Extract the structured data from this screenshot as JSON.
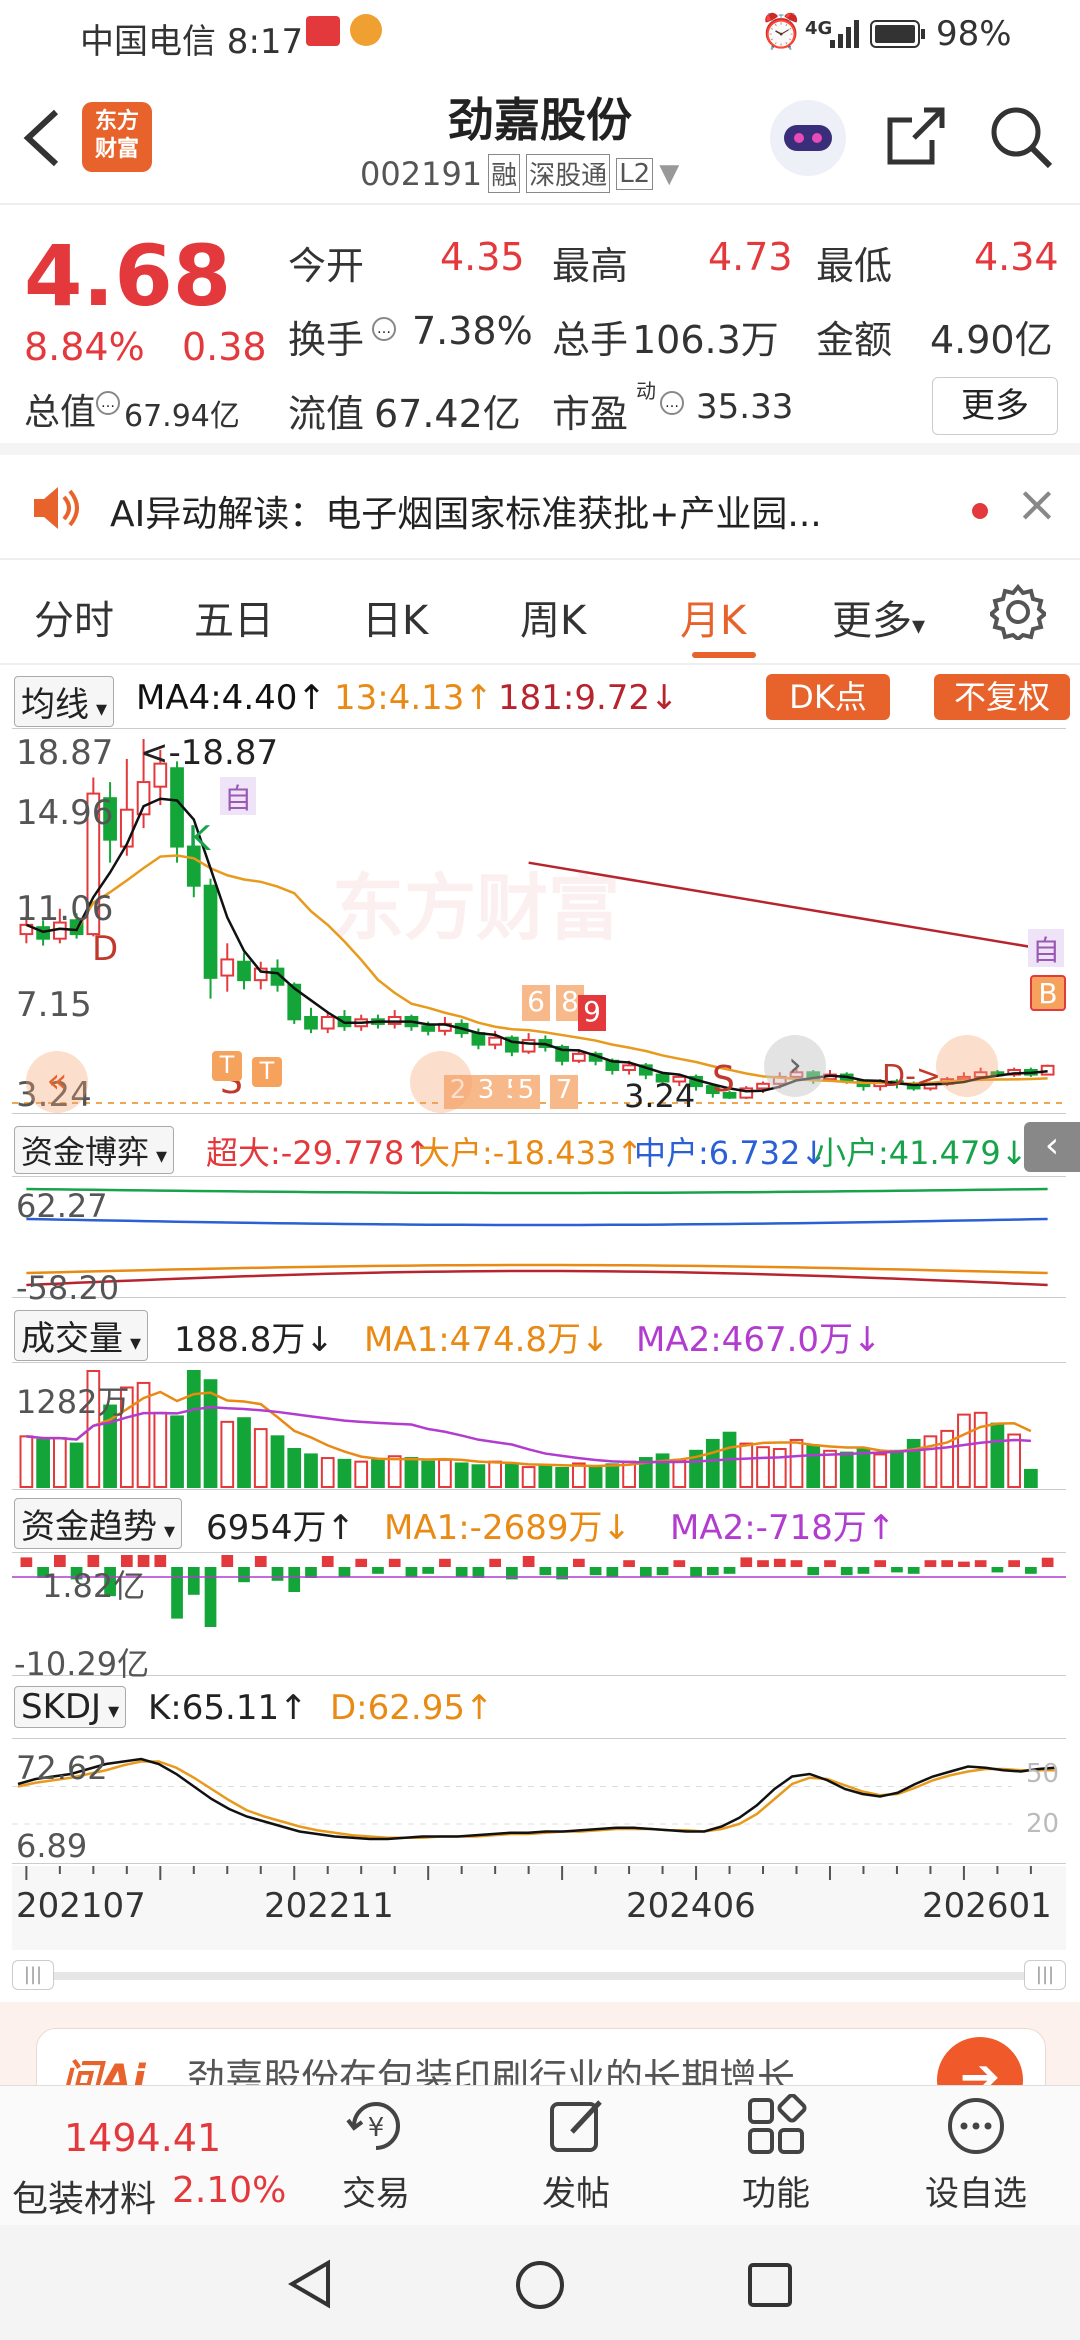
{
  "status_bar": {
    "time_carrier": "中国电信 8:17",
    "signal": "4G",
    "battery": "98%"
  },
  "header": {
    "title": "劲嘉股份",
    "code": "002191",
    "badges": [
      "融",
      "深股通",
      "L2"
    ],
    "brand": "东方\n财富"
  },
  "quote": {
    "price": "4.68",
    "change_pct": "8.84%",
    "change": "0.38",
    "open_label": "今开",
    "open": "4.35",
    "high_label": "最高",
    "high": "4.73",
    "low_label": "最低",
    "low": "4.34",
    "turnover_label": "换手",
    "turnover": "7.38%",
    "volume_label": "总手",
    "volume": "106.3万",
    "amount_label": "金额",
    "amount": "4.90亿",
    "mktcap_label": "总值",
    "mktcap": "67.94亿",
    "float_label": "流值",
    "float_cap": "67.42亿",
    "pe_label": "市盈",
    "pe_sup": "动",
    "pe": "35.33",
    "more_button": "更多"
  },
  "ai_banner": {
    "text": "AI异动解读：电子烟国家标准获批+产业园...",
    "close": "×"
  },
  "tabs": {
    "items": [
      "分时",
      "五日",
      "日K",
      "周K",
      "月K",
      "更多"
    ],
    "active": 4,
    "more_caret": "▾"
  },
  "kline": {
    "indicator_label": "均线",
    "ma4": "MA4:4.40↑",
    "ma13": "13:4.13↑",
    "ma181": "181:9.72↓",
    "dk_button": "DK点",
    "adjust_button": "不复权",
    "y_labels": [
      "18.87",
      "14.96",
      "11.06",
      "7.15",
      "3.24"
    ],
    "max_annotation": "<-18.87",
    "min_annotation": "3.24",
    "watermark": "东方财富",
    "markers": {
      "zi": "自",
      "k": "K",
      "d": "D",
      "s": "S",
      "t": "T",
      "b": "B"
    },
    "number_tags": [
      "2",
      "3",
      "5",
      "5",
      "7",
      "6",
      "8",
      "9"
    ],
    "ddash": "D->",
    "colors": {
      "up": "#e4393c",
      "down": "#13a538",
      "ma4": "#111111",
      "ma13": "#e89a1c",
      "ma181": "#b8242e"
    }
  },
  "capital_game": {
    "label": "资金博弈",
    "super": "超大:-29.778↑",
    "large": "大户:-18.433↑",
    "mid": "中户:6.732↓",
    "small": "小户:41.479↓",
    "y_labels": [
      "62.27",
      "-58.20"
    ]
  },
  "volume": {
    "label": "成交量",
    "value": "188.8万↓",
    "ma1": "MA1:474.8万↓",
    "ma2": "MA2:467.0万↓",
    "y_labels": [
      "1282万"
    ]
  },
  "fund_trend": {
    "label": "资金趋势",
    "value": "6954万↑",
    "ma1": "MA1:-2689万↓",
    "ma2": "MA2:-718万↑",
    "y_labels": [
      "1.82亿",
      "-10.29亿"
    ]
  },
  "skdj": {
    "label": "SKDJ",
    "k": "K:65.11↑",
    "d": "D:62.95↑",
    "y_labels": [
      "72.62",
      "6.89"
    ],
    "right_labels": [
      "50",
      "20"
    ]
  },
  "x_axis": [
    "202107",
    "202211",
    "202406",
    "202601"
  ],
  "promo": {
    "text": "劲嘉股份在包装印刷行业的长期增长"
  },
  "bottom_bar": {
    "index_value": "1494.41",
    "index_name": "包装材料",
    "index_pct": "2.10%",
    "items": [
      {
        "label": "交易",
        "icon": "trade-icon"
      },
      {
        "label": "发帖",
        "icon": "post-icon"
      },
      {
        "label": "功能",
        "icon": "function-icon"
      },
      {
        "label": "设自选",
        "icon": "watchlist-icon"
      }
    ]
  },
  "chart_data": {
    "type": "candlestick",
    "title": "劲嘉股份 月K",
    "x_ticks": [
      "202107",
      "202211",
      "202406",
      "202601"
    ],
    "ylim": [
      3.24,
      18.87
    ],
    "y_ticks": [
      18.87,
      14.96,
      11.06,
      7.15,
      3.24
    ],
    "candles": [
      {
        "o": 10.4,
        "c": 10.8,
        "h": 11.2,
        "l": 10.0
      },
      {
        "o": 10.7,
        "c": 10.2,
        "h": 11.0,
        "l": 9.9
      },
      {
        "o": 10.2,
        "c": 10.9,
        "h": 11.5,
        "l": 10.0
      },
      {
        "o": 11.0,
        "c": 10.4,
        "h": 11.3,
        "l": 10.2
      },
      {
        "o": 10.4,
        "c": 16.5,
        "h": 17.2,
        "l": 10.3
      },
      {
        "o": 16.3,
        "c": 14.5,
        "h": 17.0,
        "l": 13.5
      },
      {
        "o": 14.2,
        "c": 15.8,
        "h": 18.0,
        "l": 13.8
      },
      {
        "o": 15.6,
        "c": 17.0,
        "h": 18.87,
        "l": 15.0
      },
      {
        "o": 16.8,
        "c": 17.8,
        "h": 18.4,
        "l": 16.0
      },
      {
        "o": 17.6,
        "c": 14.2,
        "h": 17.9,
        "l": 13.5
      },
      {
        "o": 14.2,
        "c": 12.5,
        "h": 14.5,
        "l": 12.0
      },
      {
        "o": 12.5,
        "c": 8.5,
        "h": 12.8,
        "l": 7.6
      },
      {
        "o": 8.6,
        "c": 9.3,
        "h": 10.0,
        "l": 7.9
      },
      {
        "o": 9.2,
        "c": 8.4,
        "h": 9.6,
        "l": 8.0
      },
      {
        "o": 8.4,
        "c": 8.9,
        "h": 9.2,
        "l": 8.0
      },
      {
        "o": 8.9,
        "c": 8.2,
        "h": 9.3,
        "l": 7.9
      },
      {
        "o": 8.2,
        "c": 6.7,
        "h": 8.3,
        "l": 6.5
      },
      {
        "o": 6.8,
        "c": 6.3,
        "h": 7.2,
        "l": 6.1
      },
      {
        "o": 6.3,
        "c": 6.8,
        "h": 7.0,
        "l": 6.1
      },
      {
        "o": 6.8,
        "c": 6.4,
        "h": 7.1,
        "l": 6.2
      },
      {
        "o": 6.4,
        "c": 6.7,
        "h": 6.9,
        "l": 6.2
      },
      {
        "o": 6.7,
        "c": 6.5,
        "h": 6.9,
        "l": 6.3
      },
      {
        "o": 6.5,
        "c": 6.8,
        "h": 7.1,
        "l": 6.3
      },
      {
        "o": 6.8,
        "c": 6.4,
        "h": 6.9,
        "l": 6.2
      },
      {
        "o": 6.4,
        "c": 6.2,
        "h": 6.6,
        "l": 6.0
      },
      {
        "o": 6.2,
        "c": 6.5,
        "h": 6.8,
        "l": 6.0
      },
      {
        "o": 6.5,
        "c": 6.1,
        "h": 6.7,
        "l": 5.9
      },
      {
        "o": 6.1,
        "c": 5.6,
        "h": 6.3,
        "l": 5.4
      },
      {
        "o": 5.6,
        "c": 5.9,
        "h": 6.2,
        "l": 5.4
      },
      {
        "o": 5.9,
        "c": 5.3,
        "h": 6.0,
        "l": 5.1
      },
      {
        "o": 5.3,
        "c": 5.8,
        "h": 6.1,
        "l": 5.2
      },
      {
        "o": 5.8,
        "c": 5.5,
        "h": 6.0,
        "l": 5.3
      },
      {
        "o": 5.5,
        "c": 4.9,
        "h": 5.6,
        "l": 4.7
      },
      {
        "o": 4.9,
        "c": 5.2,
        "h": 5.4,
        "l": 4.8
      },
      {
        "o": 5.2,
        "c": 4.9,
        "h": 5.3,
        "l": 4.7
      },
      {
        "o": 4.9,
        "c": 4.5,
        "h": 5.0,
        "l": 4.3
      },
      {
        "o": 4.5,
        "c": 4.7,
        "h": 4.9,
        "l": 4.3
      },
      {
        "o": 4.7,
        "c": 4.3,
        "h": 4.8,
        "l": 4.1
      },
      {
        "o": 4.3,
        "c": 4.0,
        "h": 4.4,
        "l": 3.8
      },
      {
        "o": 4.0,
        "c": 4.2,
        "h": 4.3,
        "l": 3.8
      },
      {
        "o": 4.2,
        "c": 3.8,
        "h": 4.3,
        "l": 3.6
      },
      {
        "o": 3.8,
        "c": 3.5,
        "h": 3.9,
        "l": 3.3
      },
      {
        "o": 3.5,
        "c": 3.3,
        "h": 3.6,
        "l": 3.24
      },
      {
        "o": 3.3,
        "c": 3.7,
        "h": 3.8,
        "l": 3.24
      },
      {
        "o": 3.7,
        "c": 3.9,
        "h": 4.0,
        "l": 3.5
      },
      {
        "o": 3.9,
        "c": 4.2,
        "h": 4.4,
        "l": 3.7
      },
      {
        "o": 4.2,
        "c": 4.4,
        "h": 4.6,
        "l": 4.0
      },
      {
        "o": 4.4,
        "c": 4.1,
        "h": 4.5,
        "l": 3.9
      },
      {
        "o": 4.1,
        "c": 4.3,
        "h": 4.5,
        "l": 4.0
      },
      {
        "o": 4.3,
        "c": 4.0,
        "h": 4.4,
        "l": 3.9
      },
      {
        "o": 4.0,
        "c": 3.8,
        "h": 4.1,
        "l": 3.6
      },
      {
        "o": 3.8,
        "c": 4.0,
        "h": 4.1,
        "l": 3.6
      },
      {
        "o": 4.0,
        "c": 3.9,
        "h": 4.1,
        "l": 3.7
      },
      {
        "o": 3.9,
        "c": 3.7,
        "h": 4.0,
        "l": 3.6
      },
      {
        "o": 3.7,
        "c": 3.9,
        "h": 4.0,
        "l": 3.6
      },
      {
        "o": 3.9,
        "c": 4.1,
        "h": 4.2,
        "l": 3.8
      },
      {
        "o": 4.1,
        "c": 4.2,
        "h": 4.4,
        "l": 4.0
      },
      {
        "o": 4.2,
        "c": 4.4,
        "h": 4.6,
        "l": 4.1
      },
      {
        "o": 4.4,
        "c": 4.3,
        "h": 4.5,
        "l": 4.2
      },
      {
        "o": 4.3,
        "c": 4.5,
        "h": 4.6,
        "l": 4.2
      },
      {
        "o": 4.5,
        "c": 4.3,
        "h": 4.6,
        "l": 4.2
      },
      {
        "o": 4.3,
        "c": 4.68,
        "h": 4.73,
        "l": 4.3
      }
    ],
    "ma181": [
      [
        30,
        13.5
      ],
      [
        61,
        9.72
      ]
    ],
    "volume": [
      560,
      520,
      540,
      480,
      1282,
      900,
      1100,
      1150,
      820,
      780,
      1282,
      1180,
      720,
      760,
      640,
      560,
      420,
      360,
      320,
      300,
      280,
      300,
      340,
      320,
      280,
      300,
      260,
      240,
      280,
      250,
      220,
      240,
      210,
      260,
      230,
      250,
      280,
      320,
      360,
      300,
      400,
      520,
      600,
      480,
      440,
      420,
      520,
      460,
      400,
      380,
      420,
      360,
      400,
      520,
      560,
      620,
      800,
      820,
      700,
      580,
      188.8
    ],
    "skdj_k": [
      52,
      56,
      58,
      60,
      64,
      68,
      70,
      72,
      68,
      60,
      50,
      40,
      32,
      26,
      22,
      18,
      14,
      12,
      10,
      9,
      8,
      8,
      9,
      10,
      10,
      10,
      11,
      12,
      13,
      13,
      14,
      14,
      15,
      16,
      17,
      17,
      16,
      15,
      14,
      14,
      18,
      25,
      35,
      48,
      58,
      60,
      55,
      48,
      44,
      42,
      45,
      52,
      58,
      62,
      66,
      65,
      63,
      62,
      64,
      65.11
    ],
    "skdj_d": [
      50,
      53,
      55,
      57,
      60,
      63,
      67,
      70,
      70,
      65,
      57,
      48,
      39,
      31,
      26,
      22,
      18,
      15,
      13,
      11,
      10,
      9,
      9,
      9,
      10,
      10,
      10,
      11,
      12,
      12,
      13,
      14,
      14,
      15,
      16,
      16,
      16,
      15,
      15,
      14,
      16,
      20,
      28,
      40,
      52,
      57,
      56,
      51,
      46,
      43,
      44,
      49,
      55,
      59,
      62,
      64,
      64,
      63,
      63,
      62.95
    ]
  }
}
